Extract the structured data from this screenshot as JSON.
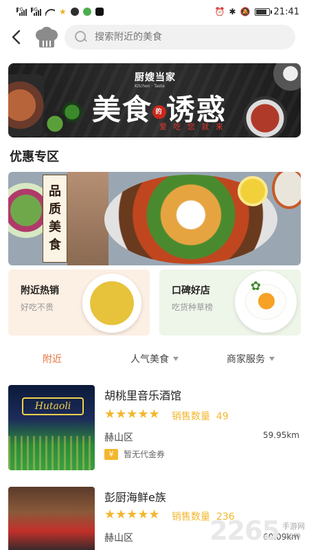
{
  "status_bar": {
    "signal1_label": "2G",
    "signal2_label": "4G",
    "time": "21:41"
  },
  "search": {
    "placeholder": "搜索附近的美食"
  },
  "banner": {
    "brand": "厨嫂当家",
    "brand_small": "Kitchen · Taste",
    "title_left": "美食",
    "title_dot": "的",
    "title_right": "诱惑",
    "subtitle": "爱 吃 您 就 来"
  },
  "section": {
    "title": "优惠专区"
  },
  "promo": {
    "tag_chars": [
      "品",
      "质",
      "美",
      "食"
    ]
  },
  "cards": [
    {
      "title": "附近热销",
      "subtitle": "好吃不贵"
    },
    {
      "title": "口碑好店",
      "subtitle": "吃货种草榜"
    }
  ],
  "tabs": [
    {
      "label": "附近",
      "active": true,
      "dropdown": false
    },
    {
      "label": "人气美食",
      "active": false,
      "dropdown": true
    },
    {
      "label": "商家服务",
      "active": false,
      "dropdown": true
    }
  ],
  "restaurants": [
    {
      "name": "胡桃里音乐酒馆",
      "stars": "★★★★★",
      "rating": 5,
      "sales_label": "销售数量",
      "sales_count": "49",
      "district": "赫山区",
      "distance": "59.95km",
      "coupon_icon": "¥",
      "coupon": "暂无代金券",
      "sign_text": "Hutaoli"
    },
    {
      "name": "彭厨海鲜e族",
      "stars": "★★★★★",
      "rating": 5,
      "sales_label": "销售数量",
      "sales_count": "236",
      "district": "赫山区",
      "distance": "60.09km"
    }
  ],
  "watermark": {
    "number": "2265",
    "line1": "手游网",
    "line2": ".com"
  },
  "colors": {
    "accent": "#e5723b",
    "star": "#f3b72e",
    "search_bg": "#f1f1f1"
  }
}
